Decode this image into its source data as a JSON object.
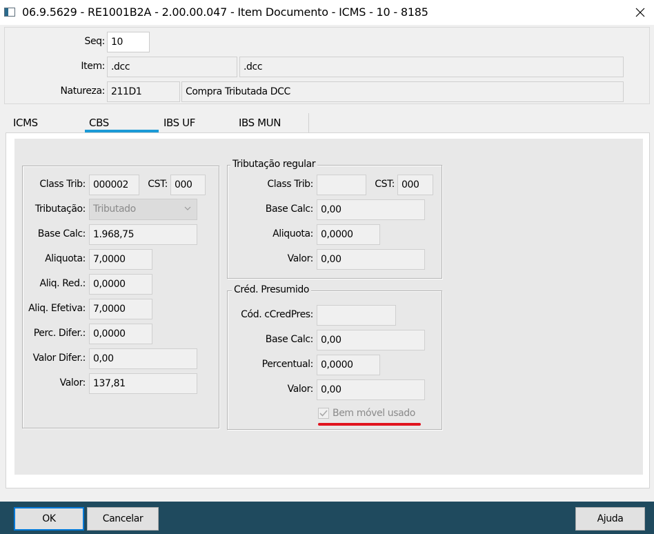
{
  "window": {
    "title": "06.9.5629 - RE1001B2A - 2.00.00.047 - Item Documento - ICMS - 10 - 8185",
    "close_icon": "close-icon",
    "app_icon": "window-app-icon"
  },
  "header": {
    "seq_label": "Seq:",
    "seq_value": "10",
    "item_label": "Item:",
    "item_code": ".dcc",
    "item_desc": ".dcc",
    "natureza_label": "Natureza:",
    "natureza_code": "211D1",
    "natureza_desc": "Compra Tributada DCC"
  },
  "tabs": [
    {
      "label": "ICMS",
      "active": false
    },
    {
      "label": "CBS",
      "active": true
    },
    {
      "label": "IBS UF",
      "active": false
    },
    {
      "label": "IBS MUN",
      "active": false
    }
  ],
  "colors": {
    "accent": "#1a9ad6",
    "bottom_bar": "#1f4a5e",
    "highlight_underline": "#e0141e"
  },
  "left_group": {
    "class_trib_label": "Class Trib:",
    "class_trib_value": "000002",
    "cst_label": "CST:",
    "cst_value": "000",
    "tributacao_label": "Tributação:",
    "tributacao_value": "Tributado",
    "base_calc_label": "Base Calc:",
    "base_calc_value": "1.968,75",
    "aliquota_label": "Aliquota:",
    "aliquota_value": "7,0000",
    "aliq_red_label": "Aliq. Red.:",
    "aliq_red_value": "0,0000",
    "aliq_efetiva_label": "Aliq. Efetiva:",
    "aliq_efetiva_value": "7,0000",
    "perc_difer_label": "Perc. Difer.:",
    "perc_difer_value": "0,0000",
    "valor_difer_label": "Valor Difer.:",
    "valor_difer_value": "0,00",
    "valor_label": "Valor:",
    "valor_value": "137,81"
  },
  "tributacao_regular": {
    "legend": "Tributação regular",
    "class_trib_label": "Class Trib:",
    "class_trib_value": "",
    "cst_label": "CST:",
    "cst_value": "000",
    "base_calc_label": "Base Calc:",
    "base_calc_value": "0,00",
    "aliquota_label": "Aliquota:",
    "aliquota_value": "0,0000",
    "valor_label": "Valor:",
    "valor_value": "0,00"
  },
  "cred_presumido": {
    "legend": "Créd. Presumido",
    "cod_label": "Cód. cCredPres:",
    "cod_value": "",
    "base_calc_label": "Base Calc:",
    "base_calc_value": "0,00",
    "percentual_label": "Percentual:",
    "percentual_value": "0,0000",
    "valor_label": "Valor:",
    "valor_value": "0,00",
    "bem_movel_label": "Bem móvel usado",
    "bem_movel_checked": true
  },
  "buttons": {
    "ok": "OK",
    "cancelar": "Cancelar",
    "ajuda": "Ajuda"
  }
}
